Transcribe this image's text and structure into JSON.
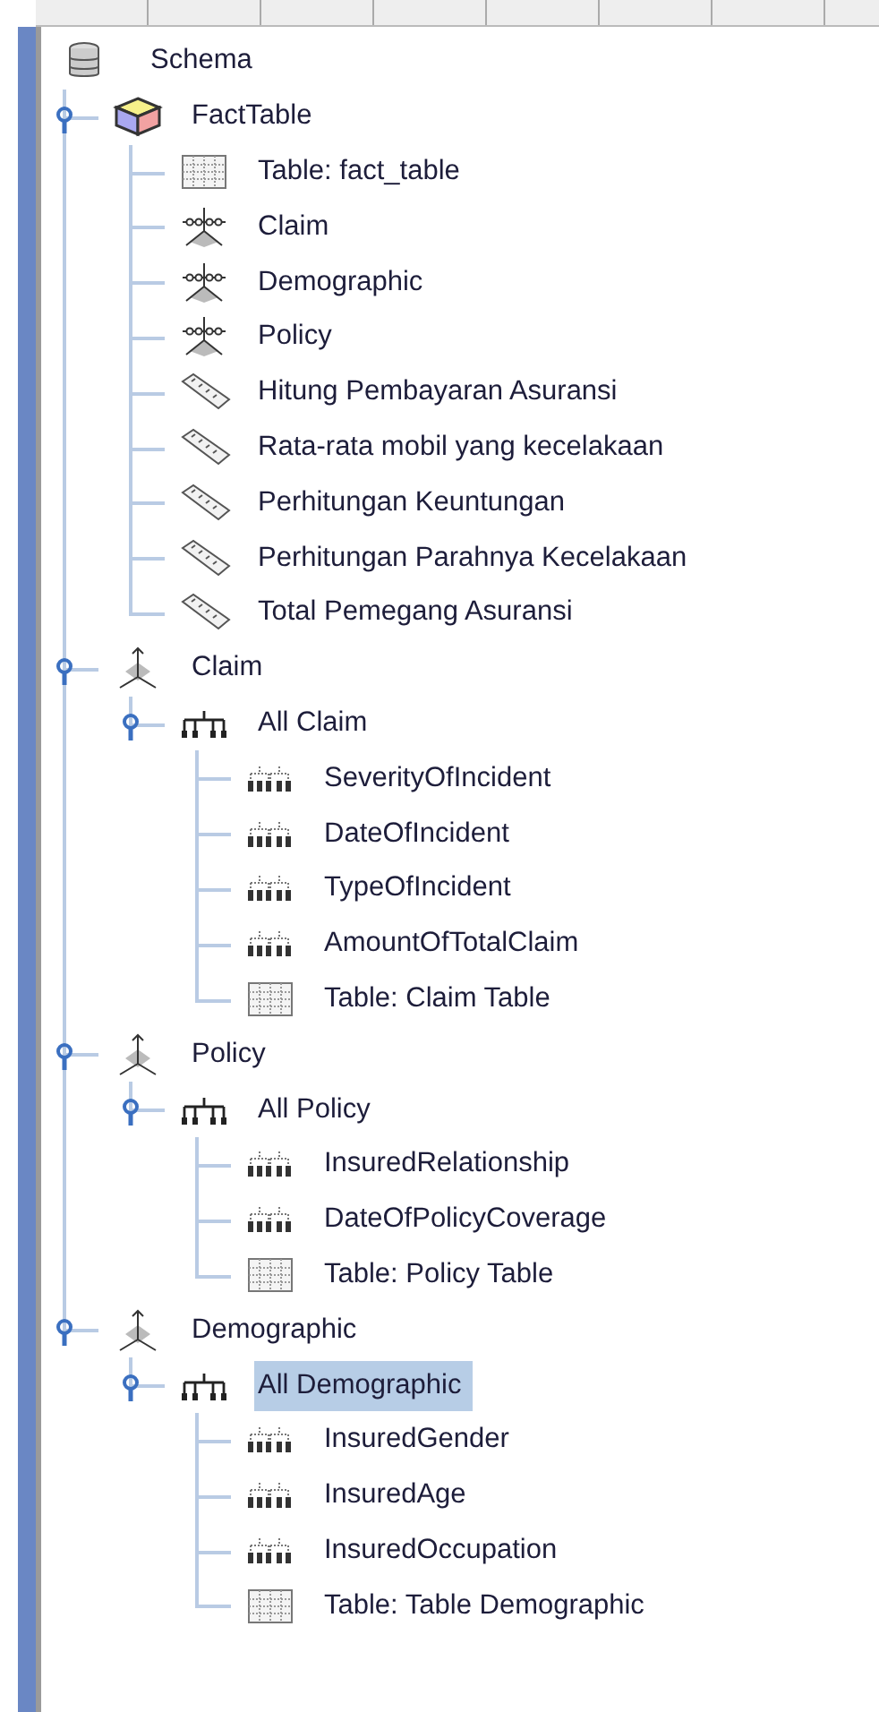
{
  "tree": {
    "kind": "schema",
    "label": "Schema",
    "selected": false,
    "children": [
      {
        "kind": "cube",
        "label": "FactTable",
        "expanded": true,
        "selected": false,
        "children": [
          {
            "kind": "table",
            "label": "Table: fact_table",
            "selected": false
          },
          {
            "kind": "dimension_usage",
            "label": "Claim",
            "selected": false
          },
          {
            "kind": "dimension_usage",
            "label": "Demographic",
            "selected": false
          },
          {
            "kind": "dimension_usage",
            "label": "Policy",
            "selected": false
          },
          {
            "kind": "measure",
            "label": "Hitung Pembayaran Asuransi",
            "selected": false
          },
          {
            "kind": "measure",
            "label": "Rata-rata mobil yang kecelakaan",
            "selected": false
          },
          {
            "kind": "measure",
            "label": "Perhitungan Keuntungan",
            "selected": false
          },
          {
            "kind": "measure",
            "label": "Perhitungan Parahnya Kecelakaan",
            "selected": false
          },
          {
            "kind": "measure",
            "label": "Total Pemegang Asuransi",
            "selected": false
          }
        ]
      },
      {
        "kind": "dimension",
        "label": "Claim",
        "expanded": true,
        "selected": false,
        "children": [
          {
            "kind": "hierarchy",
            "label": "All Claim",
            "expanded": true,
            "selected": false,
            "children": [
              {
                "kind": "level",
                "label": "SeverityOfIncident",
                "selected": false
              },
              {
                "kind": "level",
                "label": "DateOfIncident",
                "selected": false
              },
              {
                "kind": "level",
                "label": "TypeOfIncident",
                "selected": false
              },
              {
                "kind": "level",
                "label": "AmountOfTotalClaim",
                "selected": false
              },
              {
                "kind": "table",
                "label": "Table: Claim Table",
                "selected": false
              }
            ]
          }
        ]
      },
      {
        "kind": "dimension",
        "label": "Policy",
        "expanded": true,
        "selected": false,
        "children": [
          {
            "kind": "hierarchy",
            "label": "All Policy",
            "expanded": true,
            "selected": false,
            "children": [
              {
                "kind": "level",
                "label": "InsuredRelationship",
                "selected": false
              },
              {
                "kind": "level",
                "label": "DateOfPolicyCoverage",
                "selected": false
              },
              {
                "kind": "table",
                "label": "Table: Policy Table",
                "selected": false
              }
            ]
          }
        ]
      },
      {
        "kind": "dimension",
        "label": "Demographic",
        "expanded": true,
        "selected": false,
        "children": [
          {
            "kind": "hierarchy",
            "label": "All Demographic",
            "expanded": true,
            "selected": true,
            "children": [
              {
                "kind": "level",
                "label": "InsuredGender",
                "selected": false
              },
              {
                "kind": "level",
                "label": "InsuredAge",
                "selected": false
              },
              {
                "kind": "level",
                "label": "InsuredOccupation",
                "selected": false
              },
              {
                "kind": "table",
                "label": "Table: Table Demographic",
                "selected": false
              }
            ]
          }
        ]
      }
    ]
  }
}
